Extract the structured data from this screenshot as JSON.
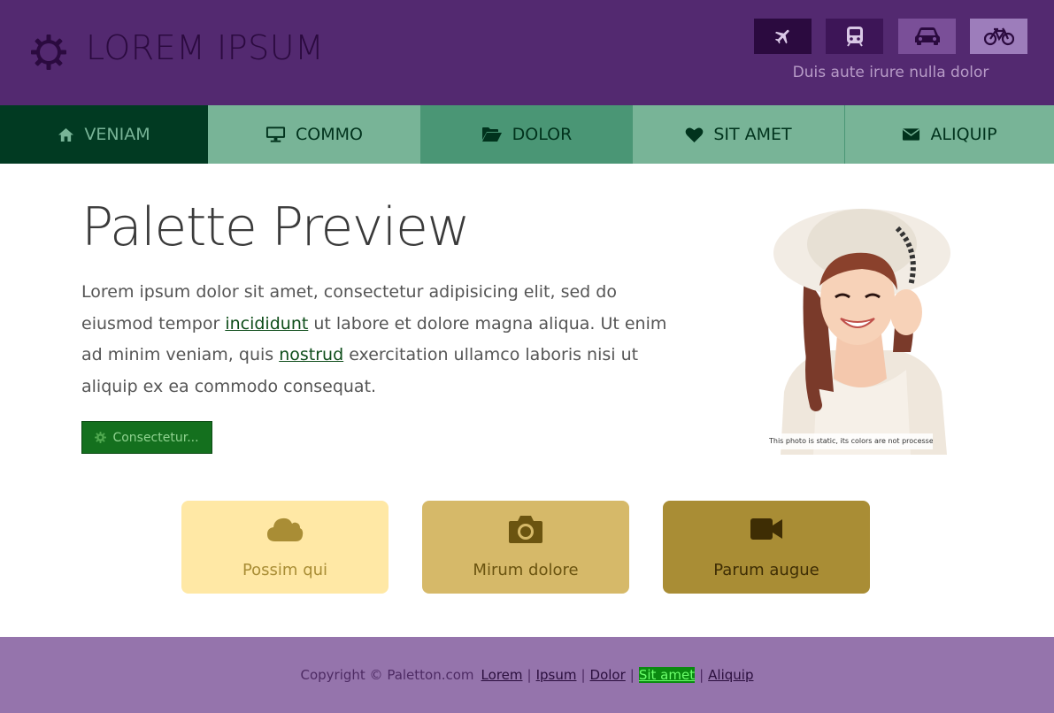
{
  "colors": {
    "header_bg": "#532970",
    "nav_active": "#013a22",
    "nav_light": "#78b497",
    "nav_mid": "#4a9675",
    "button_bg": "#14701e",
    "footer_bg": "#9574ac",
    "card1": "#ffe8a5",
    "card2": "#d6b969",
    "card3": "#a98d35"
  },
  "header": {
    "logo_icon": "gear-icon",
    "title": "LOREM IPSUM",
    "tagline": "Duis aute irure nulla dolor",
    "transport_buttons": [
      {
        "icon": "plane-icon"
      },
      {
        "icon": "train-icon"
      },
      {
        "icon": "car-icon"
      },
      {
        "icon": "bicycle-icon"
      }
    ]
  },
  "nav": {
    "items": [
      {
        "label": "VENIAM",
        "icon": "home-icon"
      },
      {
        "label": "COMMO",
        "icon": "desktop-icon"
      },
      {
        "label": "DOLOR",
        "icon": "folder-open-icon"
      },
      {
        "label": "SIT AMET",
        "icon": "heart-icon"
      },
      {
        "label": "ALIQUIP",
        "icon": "envelope-icon"
      }
    ]
  },
  "main": {
    "title": "Palette Preview",
    "para": {
      "t1": "Lorem ipsum dolor sit amet, consectetur adipisicing elit, sed do eiusmod tempor ",
      "link1": "incididunt",
      "t2": " ut labore et dolore magna aliqua. Ut enim ad minim veniam, quis ",
      "link2": "nostrud",
      "t3": " exercitation ullamco laboris nisi ut aliquip ex ea commodo consequat."
    },
    "button_label": "Consectetur...",
    "photo_caption": "This photo is static, its colors are not processed!"
  },
  "cards": [
    {
      "label": "Possim qui",
      "icon": "cloud-icon"
    },
    {
      "label": "Mirum dolore",
      "icon": "camera-icon"
    },
    {
      "label": "Parum augue",
      "icon": "video-camera-icon"
    }
  ],
  "footer": {
    "copyright": "Copyright © Paletton.com",
    "links": [
      "Lorem",
      "Ipsum",
      "Dolor",
      "Sit amet",
      "Aliquip"
    ]
  }
}
